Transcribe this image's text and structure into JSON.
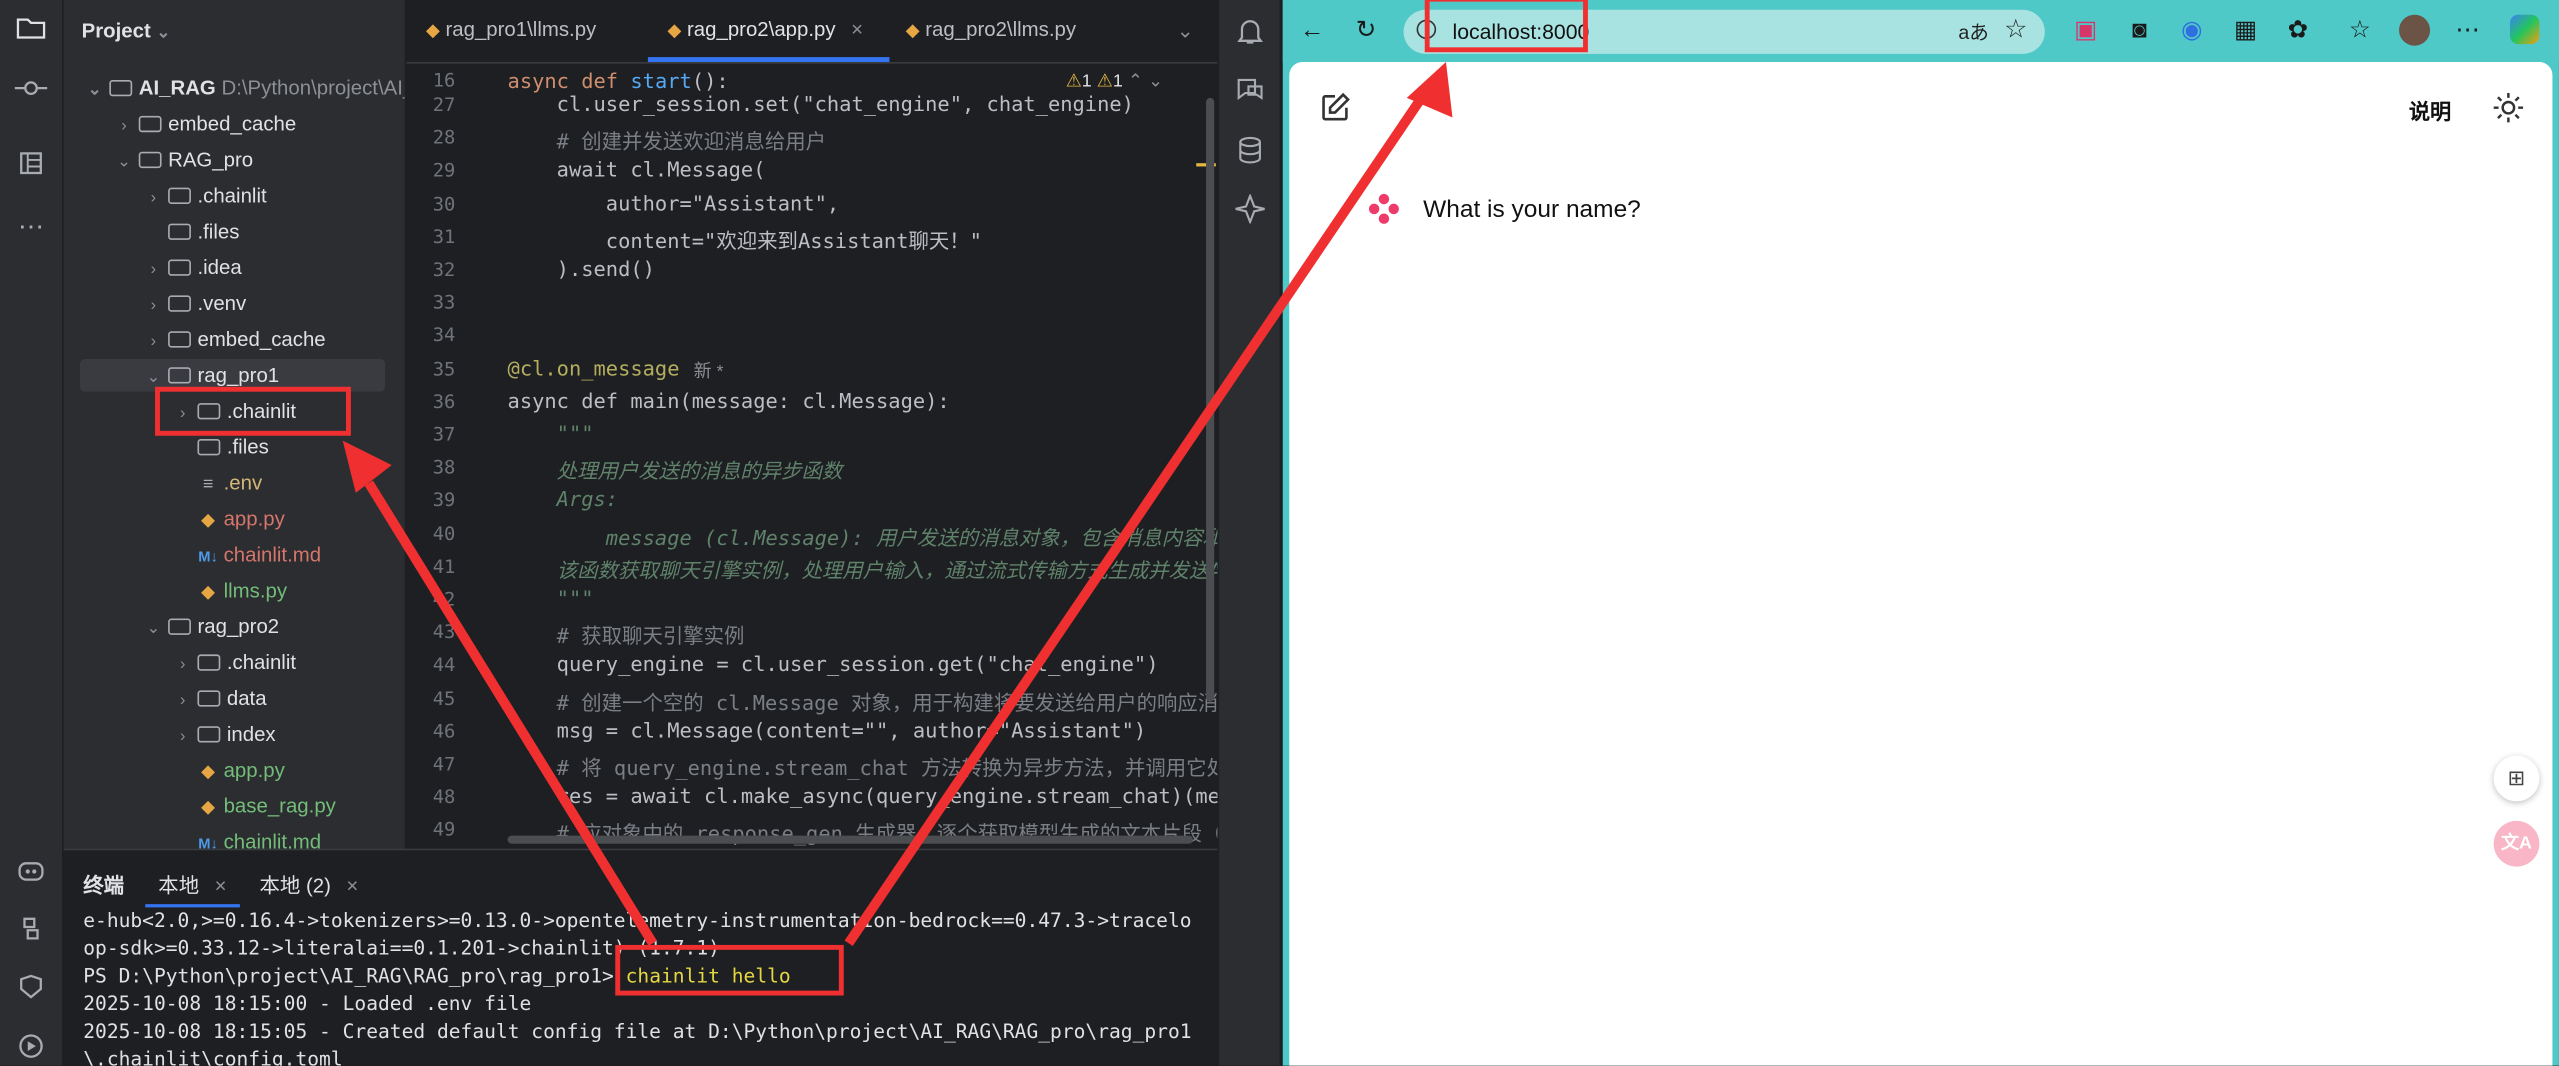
{
  "ide": {
    "project_label": "Project",
    "tree": [
      {
        "label": "AI_RAG",
        "hint": "D:\\Python\\project\\AI_RAG"
      },
      {
        "label": "embed_cache"
      },
      {
        "label": "RAG_pro"
      },
      {
        "label": ".chainlit"
      },
      {
        "label": ".files"
      },
      {
        "label": ".idea"
      },
      {
        "label": ".venv"
      },
      {
        "label": "embed_cache"
      },
      {
        "label": "rag_pro1"
      },
      {
        "label": ".chainlit"
      },
      {
        "label": ".files"
      },
      {
        "label": ".env"
      },
      {
        "label": "app.py"
      },
      {
        "label": "chainlit.md"
      },
      {
        "label": "llms.py"
      },
      {
        "label": "rag_pro2"
      },
      {
        "label": ".chainlit"
      },
      {
        "label": "data"
      },
      {
        "label": "index"
      },
      {
        "label": "app.py"
      },
      {
        "label": "base_rag.py"
      },
      {
        "label": "chainlit.md"
      }
    ],
    "tabs": [
      "rag_pro1\\llms.py",
      "rag_pro2\\app.py",
      "rag_pro2\\llms.py"
    ],
    "warnings": "1",
    "warnings2": "1",
    "sticky": {
      "line": "16",
      "code": "async def start():"
    },
    "lines": [
      {
        "n": "27",
        "code": "    cl.user_session.set(\"chat_engine\", chat_engine)"
      },
      {
        "n": "28",
        "code": "    # 创建并发送欢迎消息给用户"
      },
      {
        "n": "29",
        "code": "    await cl.Message("
      },
      {
        "n": "30",
        "code": "        author=\"Assistant\","
      },
      {
        "n": "31",
        "code": "        content=\"欢迎来到Assistant聊天！\""
      },
      {
        "n": "32",
        "code": "    ).send()"
      },
      {
        "n": "33",
        "code": ""
      },
      {
        "n": "34",
        "code": ""
      },
      {
        "n": "35",
        "code": "@cl.on_message",
        "note": "新 *"
      },
      {
        "n": "36",
        "code": "async def main(message: cl.Message):"
      },
      {
        "n": "37",
        "code": "    \"\"\""
      },
      {
        "n": "38",
        "code": "    处理用户发送的消息的异步函数"
      },
      {
        "n": "39",
        "code": "    Args:"
      },
      {
        "n": "40",
        "code": "        message (cl.Message): 用户发送的消息对象，包含消息内容和其他"
      },
      {
        "n": "41",
        "code": "    该函数获取聊天引擎实例，处理用户输入，通过流式传输方式生成并发送AI回复"
      },
      {
        "n": "42",
        "code": "    \"\"\""
      },
      {
        "n": "43",
        "code": "    # 获取聊天引擎实例"
      },
      {
        "n": "44",
        "code": "    query_engine = cl.user_session.get(\"chat_engine\")"
      },
      {
        "n": "45",
        "code": "    # 创建一个空的 cl.Message 对象，用于构建将要发送给用户的响应消息。"
      },
      {
        "n": "46",
        "code": "    msg = cl.Message(content=\"\", author=\"Assistant\")"
      },
      {
        "n": "47",
        "code": "    # 将 query_engine.stream_chat 方法转换为异步方法，并调用它处理"
      },
      {
        "n": "48",
        "code": "    res = await cl.make_async(query_engine.stream_chat)(mes"
      },
      {
        "n": "49",
        "code": "    # 应对象中的 response_gen 生成器，逐个获取模型生成的文本片段（tok"
      }
    ],
    "terminal": {
      "tabs": [
        "终端",
        "本地",
        "本地 (2)"
      ],
      "lines": [
        "e-hub<2.0,>=0.16.4->tokenizers>=0.13.0->opentelemetry-instrumentation-bedrock==0.47.3->tracelo",
        "op-sdk>=0.33.12->literalai==0.1.201->chainlit) (1.7.1)",
        "PS D:\\Python\\project\\AI_RAG\\RAG_pro\\rag_pro1> ",
        "2025-10-08 18:15:00 - Loaded .env file",
        "2025-10-08 18:15:05 - Created default config file at D:\\Python\\project\\AI_RAG\\RAG_pro\\rag_pro1",
        "\\.chainlit\\config.toml"
      ],
      "command": "chainlit hello"
    }
  },
  "browser": {
    "url": "localhost:8000",
    "read_aloud": "aあ",
    "header_link": "说明",
    "message": "What is your name?"
  }
}
